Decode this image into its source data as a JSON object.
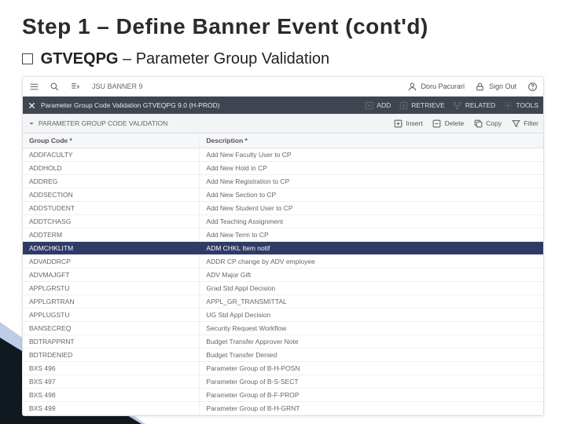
{
  "slide": {
    "title": "Step 1 – Define Banner Event (cont'd)",
    "code": "GTVEQPG",
    "code_desc": " – Parameter Group Validation"
  },
  "topbar": {
    "appname": "JSU BANNER 9",
    "user": "Doru Pacurari",
    "signout": "Sign Out"
  },
  "titlebar": {
    "title": "Parameter Group Code Validation GTVEQPG 9.0 (H-PROD)",
    "add": "ADD",
    "retrieve": "RETRIEVE",
    "related": "RELATED",
    "tools": "TOOLS"
  },
  "sectionbar": {
    "section": "PARAMETER GROUP CODE VALIDATION",
    "insert": "Insert",
    "delete": "Delete",
    "copy": "Copy",
    "filter": "Filter"
  },
  "table": {
    "col1": "Group Code *",
    "col2": "Description *",
    "rows": [
      {
        "code": "ADDFACULTY",
        "desc": "Add New Faculty User to CP"
      },
      {
        "code": "ADDHOLD",
        "desc": "Add New Hold in CP"
      },
      {
        "code": "ADDREG",
        "desc": "Add New Registration to CP"
      },
      {
        "code": "ADDSECTION",
        "desc": "Add New Section to CP"
      },
      {
        "code": "ADDSTUDENT",
        "desc": "Add New Student User to CP"
      },
      {
        "code": "ADDTCHASG",
        "desc": "Add Teaching Assignment"
      },
      {
        "code": "ADDTERM",
        "desc": "Add New Term to CP"
      },
      {
        "code": "ADMCHKLITM",
        "desc": "ADM CHKL Item notif",
        "selected": true
      },
      {
        "code": "ADVADDRCP",
        "desc": "ADDR CP change by ADV employee"
      },
      {
        "code": "ADVMAJGFT",
        "desc": "ADV Major Gift"
      },
      {
        "code": "APPLGRSTU",
        "desc": "Grad Std Appl Decision"
      },
      {
        "code": "APPLGRTRAN",
        "desc": "APPL_GR_TRANSMITTAL"
      },
      {
        "code": "APPLUGSTU",
        "desc": "UG Std Appl Decision"
      },
      {
        "code": "BANSECREQ",
        "desc": "Security Request Workflow"
      },
      {
        "code": "BDTRAPPRNT",
        "desc": "Budget Transfer Approver Note"
      },
      {
        "code": "BDTRDENIED",
        "desc": "Budget Transfer Denied"
      },
      {
        "code": "BXS 496",
        "desc": "Parameter Group of B-H-POSN"
      },
      {
        "code": "BXS 497",
        "desc": "Parameter Group of B-S-SECT"
      },
      {
        "code": "BXS 498",
        "desc": "Parameter Group of B-F-PROP"
      },
      {
        "code": "BXS 499",
        "desc": "Parameter Group of B-H-GRNT"
      }
    ]
  }
}
